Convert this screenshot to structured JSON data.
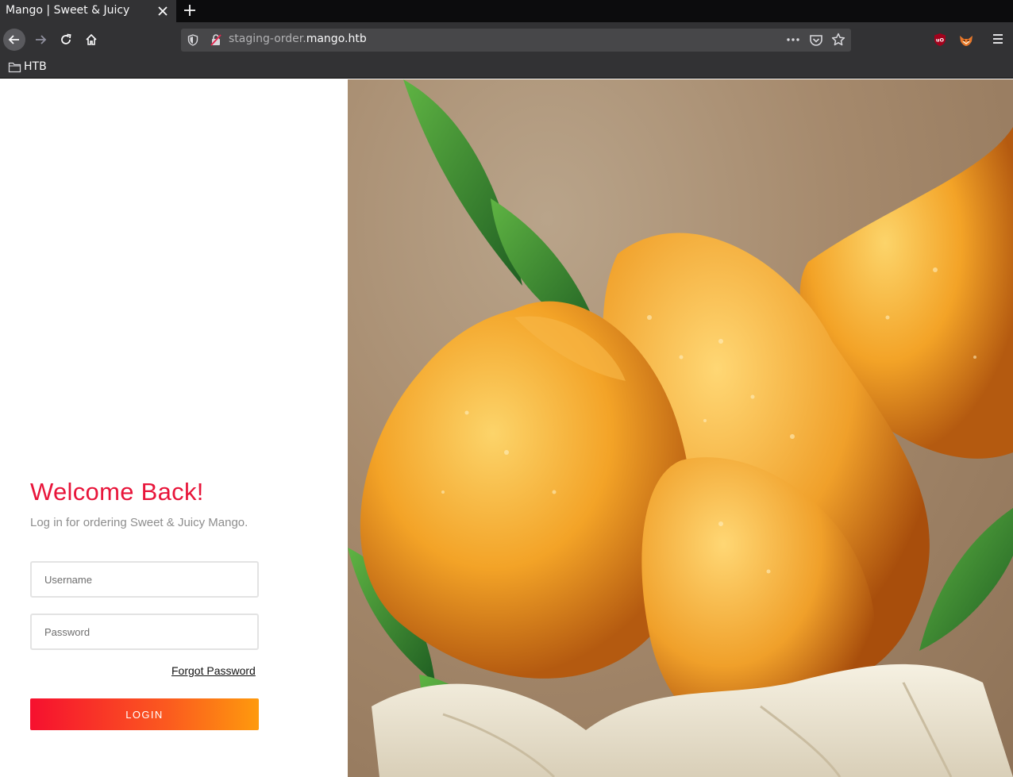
{
  "browser": {
    "tab_title": "Mango | Sweet & Juicy",
    "url_prefix": "staging-order.",
    "url_domain": "mango.htb",
    "bookmarks": [
      {
        "label": "HTB"
      }
    ]
  },
  "login": {
    "heading": "Welcome Back!",
    "subtitle": "Log in for ordering Sweet & Juicy Mango.",
    "username_placeholder": "Username",
    "password_placeholder": "Password",
    "forgot_label": "Forgot Password",
    "login_label": "LOGIN"
  },
  "colors": {
    "accent_red": "#e8153a",
    "button_gradient_start": "#f6102f",
    "button_gradient_end": "#fe9a0d",
    "mango": "#f0a226",
    "leaf": "#3f8a2e"
  },
  "hero": {
    "image": "mangoes-on-cloth",
    "icon": "mango-photo"
  }
}
